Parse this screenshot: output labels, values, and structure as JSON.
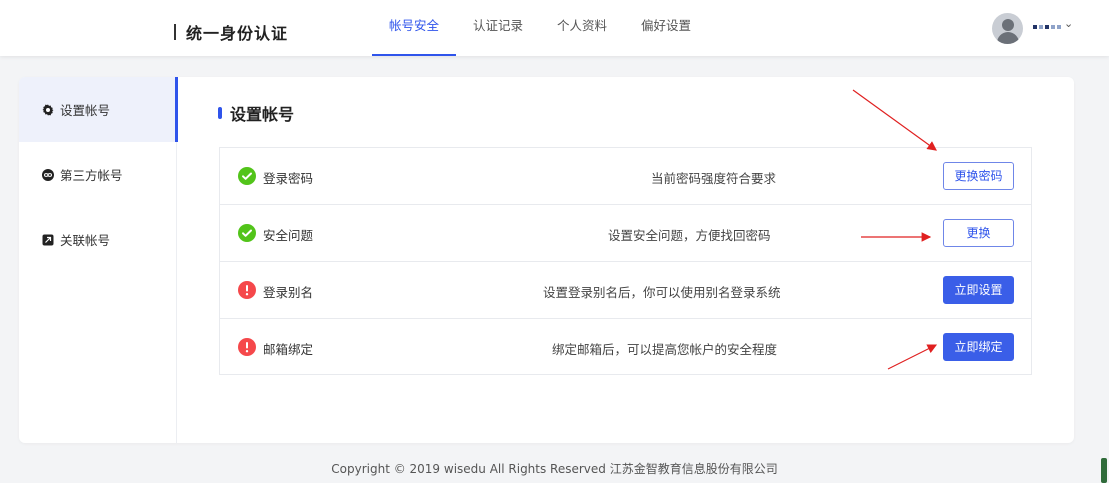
{
  "app": {
    "title": "统一身份认证"
  },
  "nav": {
    "tabs": [
      "帐号安全",
      "认证记录",
      "个人资料",
      "偏好设置"
    ],
    "active": 0
  },
  "user": {
    "chevron": "⌄"
  },
  "sidebar": {
    "items": [
      {
        "label": "设置帐号",
        "icon": "gear-icon"
      },
      {
        "label": "第三方帐号",
        "icon": "link-icon"
      },
      {
        "label": "关联帐号",
        "icon": "linked-account-icon"
      }
    ]
  },
  "main": {
    "title": "设置帐号",
    "rows": [
      {
        "status": "ok",
        "label": "登录密码",
        "desc": "当前密码强度符合要求",
        "button": "更换密码",
        "button_style": "outline"
      },
      {
        "status": "ok",
        "label": "安全问题",
        "desc": "设置安全问题，方便找回密码",
        "button": "更换",
        "button_style": "outline"
      },
      {
        "status": "warn",
        "label": "登录别名",
        "desc": "设置登录别名后，你可以使用别名登录系统",
        "button": "立即设置",
        "button_style": "solid"
      },
      {
        "status": "warn",
        "label": "邮箱绑定",
        "desc": "绑定邮箱后，可以提高您帐户的安全程度",
        "button": "立即绑定",
        "button_style": "solid"
      }
    ]
  },
  "footer": {
    "text": "Copyright © 2019 wisedu All Rights Reserved 江苏金智教育信息股份有限公司"
  },
  "colors": {
    "accent": "#2f54eb",
    "ok": "#52c41a",
    "warn": "#f5484b",
    "annotation": "#e02020"
  }
}
